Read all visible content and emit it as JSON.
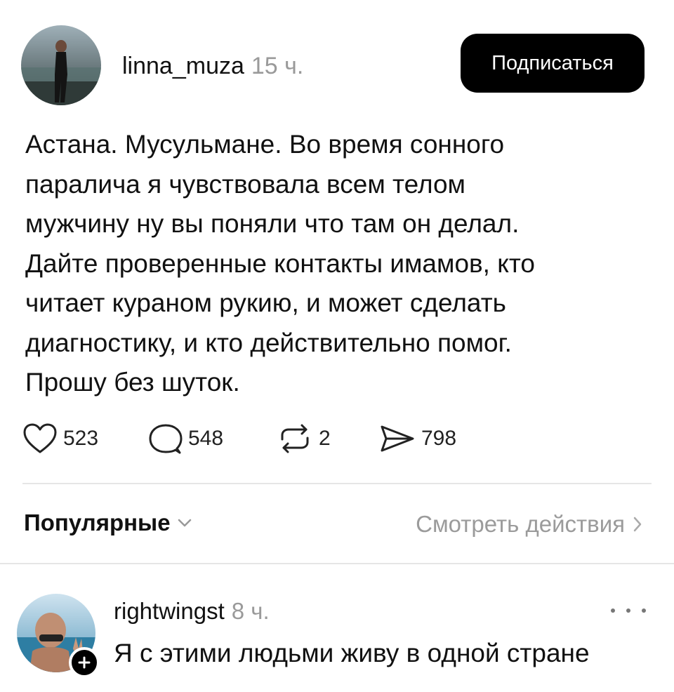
{
  "post": {
    "username": "linna_muza",
    "time": "15 ч.",
    "follow_label": "Подписаться",
    "text_lines": [
      "Астана. Мусульмане. Во время сонного",
      "паралича я чувствовала всем телом",
      "мужчину ну вы поняли что там он делал.",
      "Дайте проверенные контакты имамов, кто",
      "читает кураном рукию, и может сделать",
      "диагностику, и кто действительно помог.",
      "Прошу без шуток."
    ],
    "actions": {
      "likes": "523",
      "comments": "548",
      "reposts": "2",
      "shares": "798"
    }
  },
  "replies_bar": {
    "sort_label": "Популярные",
    "activity_label": "Смотреть действия"
  },
  "comment": {
    "username": "rightwingst",
    "time": "8 ч.",
    "text": "Я с этими людьми живу в одной стране"
  },
  "icons": {
    "like": "heart-icon",
    "comment": "speech-bubble-icon",
    "repost": "repost-icon",
    "share": "send-icon",
    "sort": "chevron-down-icon",
    "activity": "chevron-right-icon",
    "more": "more-dots-icon",
    "follow_badge": "plus-icon"
  },
  "colors": {
    "text": "#111111",
    "muted": "#9a9a9a",
    "button_bg": "#000000",
    "button_text": "#ffffff",
    "divider": "#e6e6e6"
  }
}
